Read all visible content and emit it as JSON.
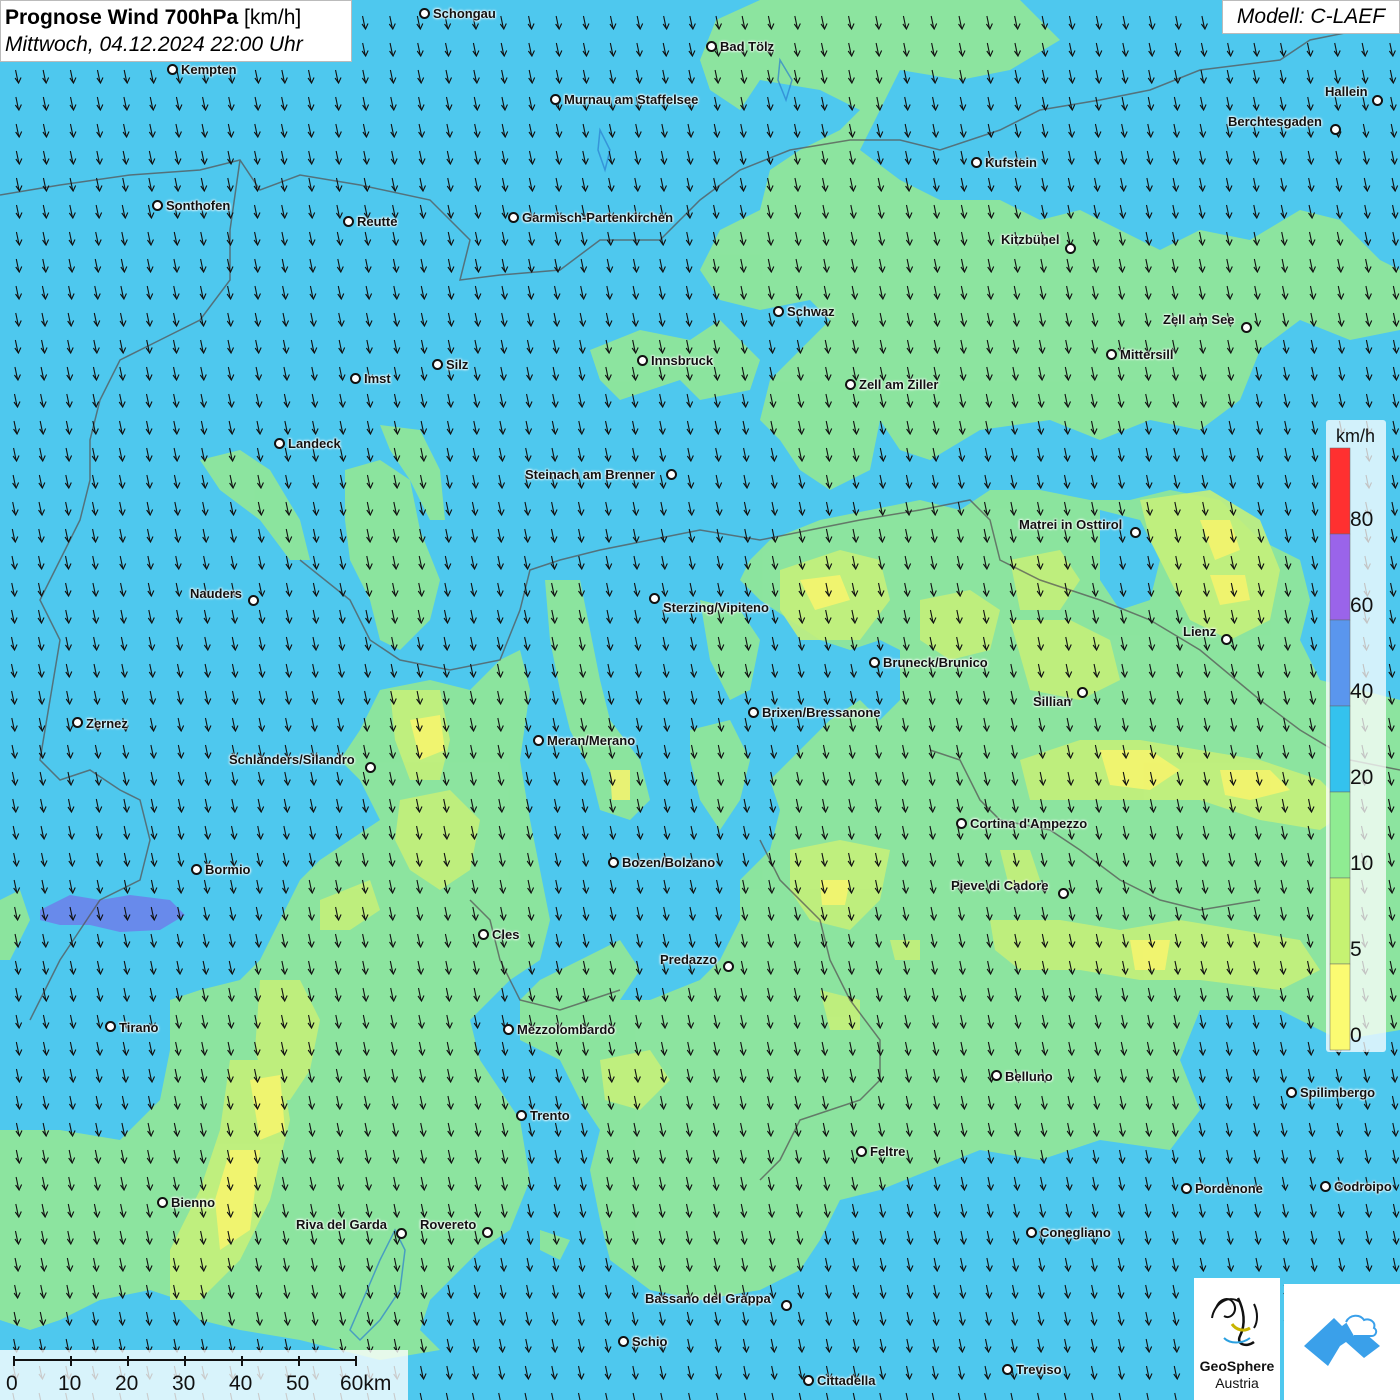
{
  "header": {
    "title": "Prognose Wind 700hPa",
    "unit": "[km/h]",
    "subtitle": "Mittwoch, 04.12.2024 22:00 Uhr"
  },
  "model": "Modell: C-LAEF",
  "legend": {
    "unit": "km/h",
    "ticks": [
      "80",
      "60",
      "40",
      "20",
      "10",
      "5",
      "0"
    ],
    "colors": [
      "#ff3030",
      "#9a64ea",
      "#5a96ee",
      "#34c2ee",
      "#8fec92",
      "#c6f272",
      "#fbfb72"
    ]
  },
  "scale_bar": {
    "labels": [
      "0",
      "10",
      "20",
      "30",
      "40",
      "50",
      "60km"
    ]
  },
  "logo": {
    "name": "GeoSphere",
    "subname": "Austria"
  },
  "colors": {
    "wind_0_5": "#f8f46c",
    "wind_5_10": "#c4f07a",
    "wind_10_20": "#8fe69a",
    "wind_20_40": "#4ec8ee",
    "wind_40_60": "#6b83ea",
    "logo_accent": "#3aa0ea"
  },
  "cities": [
    {
      "name": "Schongau"
    },
    {
      "name": "Bad Tölz"
    },
    {
      "name": "Kempten"
    },
    {
      "name": "Murnau am Staffelsee"
    },
    {
      "name": "Hallein"
    },
    {
      "name": "Berchtesgaden"
    },
    {
      "name": "Kufstein"
    },
    {
      "name": "Sonthofen"
    },
    {
      "name": "Reutte"
    },
    {
      "name": "Garmisch-Partenkirchen"
    },
    {
      "name": "Kitzbühel"
    },
    {
      "name": "Schwaz"
    },
    {
      "name": "Zell am See"
    },
    {
      "name": "Innsbruck"
    },
    {
      "name": "Mittersill"
    },
    {
      "name": "Silz"
    },
    {
      "name": "Imst"
    },
    {
      "name": "Zell am Ziller"
    },
    {
      "name": "Landeck"
    },
    {
      "name": "Steinach am Brenner"
    },
    {
      "name": "Matrei in Osttirol"
    },
    {
      "name": "Nauders"
    },
    {
      "name": "Sterzing/Vipiteno"
    },
    {
      "name": "Lienz"
    },
    {
      "name": "Bruneck/Brunico"
    },
    {
      "name": "Sillian"
    },
    {
      "name": "Brixen/Bressanone"
    },
    {
      "name": "Zernez"
    },
    {
      "name": "Meran/Merano"
    },
    {
      "name": "Schlanders/Silandro"
    },
    {
      "name": "Cortina d'Ampezzo"
    },
    {
      "name": "Bozen/Bolzano"
    },
    {
      "name": "Bormio"
    },
    {
      "name": "Pieve di Cadore"
    },
    {
      "name": "Cles"
    },
    {
      "name": "Predazzo"
    },
    {
      "name": "Tirano"
    },
    {
      "name": "Mezzolombardo"
    },
    {
      "name": "Belluno"
    },
    {
      "name": "Spilimbergo"
    },
    {
      "name": "Trento"
    },
    {
      "name": "Feltre"
    },
    {
      "name": "Pordenone"
    },
    {
      "name": "Codroipo"
    },
    {
      "name": "Bienno"
    },
    {
      "name": "Riva del Garda"
    },
    {
      "name": "Rovereto"
    },
    {
      "name": "Conegliano"
    },
    {
      "name": "Bassano del Grappa"
    },
    {
      "name": "Schio"
    },
    {
      "name": "Treviso"
    },
    {
      "name": "Cittadella"
    }
  ]
}
